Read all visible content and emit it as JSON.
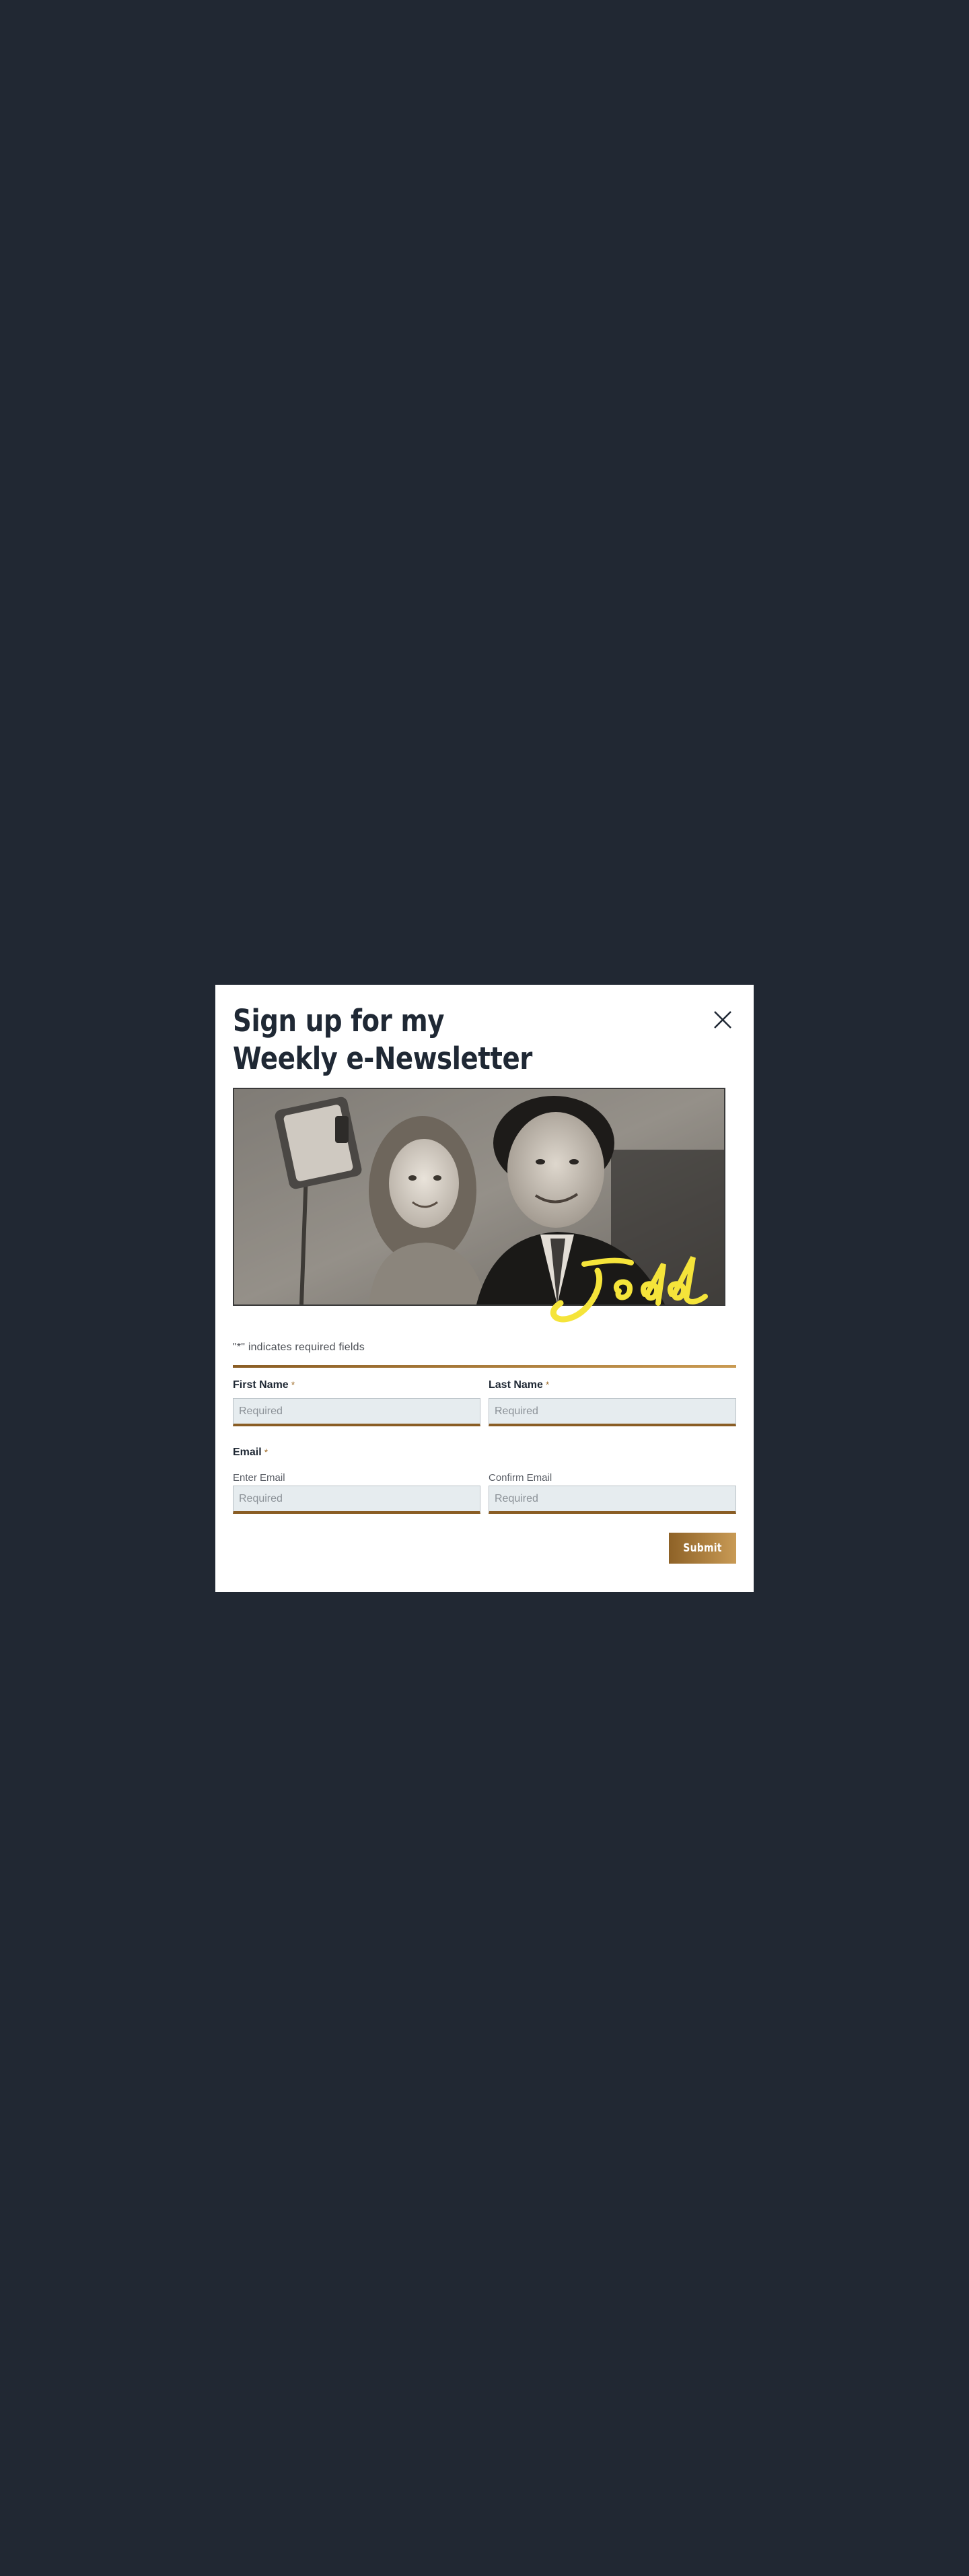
{
  "modal": {
    "title_line1": "Sign up for my",
    "title_line2": "Weekly e-Newsletter",
    "close_icon": "close-icon",
    "hero_image_alt": "Todd with a young girl taking a selfie",
    "signature_icon": "signature-icon"
  },
  "form": {
    "required_note": "\"*\" indicates required fields",
    "required_marker": "*",
    "first_name": {
      "label": "First Name",
      "placeholder": "Required",
      "value": ""
    },
    "last_name": {
      "label": "Last Name",
      "placeholder": "Required",
      "value": ""
    },
    "email": {
      "label": "Email",
      "enter_label": "Enter Email",
      "enter_placeholder": "Required",
      "confirm_label": "Confirm Email",
      "confirm_placeholder": "Required"
    },
    "submit_label": "Submit"
  },
  "colors": {
    "page_background": "#212833",
    "modal_background": "#ffffff",
    "title_text": "#1f2834",
    "accent_gold": "#8a5d24",
    "accent_gold_light": "#c99a52",
    "input_background": "#e6ecef",
    "signature_yellow": "#f5e43a"
  }
}
